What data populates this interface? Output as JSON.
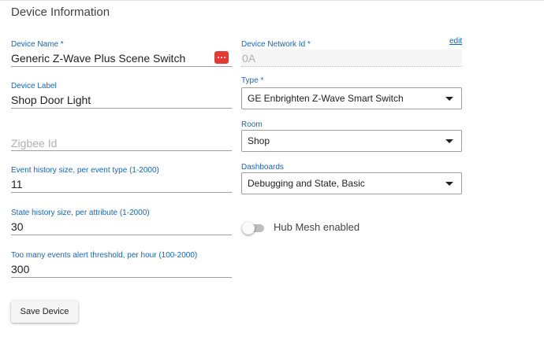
{
  "title": "Device Information",
  "fields": {
    "device_name": {
      "label": "Device Name *",
      "value": "Generic Z-Wave Plus Scene Switch"
    },
    "device_network_id": {
      "label": "Device Network Id *",
      "value": "0A",
      "edit_label": "edit"
    },
    "device_label": {
      "label": "Device Label",
      "value": "Shop Door Light"
    },
    "type": {
      "label": "Type *",
      "value": "GE Enbrighten Z-Wave Smart Switch"
    },
    "zigbee_id": {
      "placeholder": "Zigbee Id"
    },
    "room": {
      "label": "Room",
      "value": "Shop"
    },
    "event_history": {
      "label": "Event history size, per event type (1-2000)",
      "value": "11"
    },
    "dashboards": {
      "label": "Dashboards",
      "value": "Debugging and State, Basic"
    },
    "state_history": {
      "label": "State history size, per attribute (1-2000)",
      "value": "30"
    },
    "events_alert": {
      "label": "Too many events alert threshold, per hour (100-2000)",
      "value": "300"
    }
  },
  "hub_mesh": {
    "label": "Hub Mesh enabled",
    "enabled": false
  },
  "save_button": "Save Device",
  "colors": {
    "accent": "#1565c0",
    "menu_button": "#e53935"
  },
  "icons": {
    "device_name_menu": "more-dots-icon",
    "select_caret": "caret-down-icon"
  }
}
